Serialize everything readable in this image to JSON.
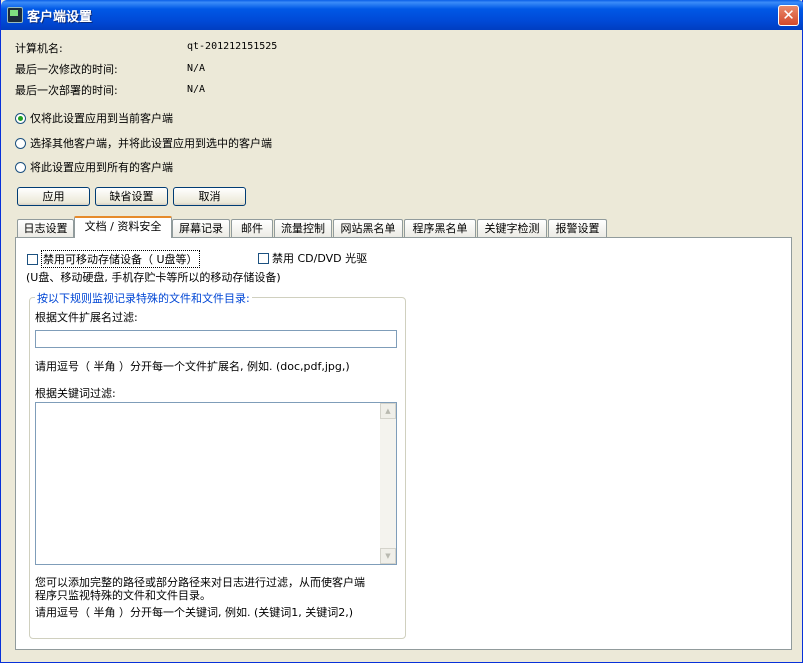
{
  "window": {
    "title": "客户端设置"
  },
  "info": {
    "computer_name_label": "计算机名:",
    "computer_name_value": "qt-201212151525",
    "last_modified_label": "最后一次修改的时间:",
    "last_modified_value": "N/A",
    "last_deployed_label": "最后一次部署的时间:",
    "last_deployed_value": "N/A"
  },
  "apply_scope": {
    "options": [
      {
        "label": "仅将此设置应用到当前客户端",
        "selected": true
      },
      {
        "label": "选择其他客户端，并将此设置应用到选中的客户端",
        "selected": false
      },
      {
        "label": "将此设置应用到所有的客户端",
        "selected": false
      }
    ]
  },
  "buttons": {
    "apply": "应用",
    "default": "缺省设置",
    "cancel": "取消"
  },
  "tabs": [
    "日志设置",
    "文档 / 资料安全",
    "屏幕记录",
    "邮件",
    "流量控制",
    "网站黑名单",
    "程序黑名单",
    "关键字检测",
    "报警设置"
  ],
  "active_tab": 1,
  "doc_security": {
    "disable_usb_label": "禁用可移动存储设备（ U盘等）",
    "disable_cd_label": "禁用 CD/DVD 光驱",
    "usb_note": "(U盘、移动硬盘, 手机存贮卡等所以的移动存储设备)",
    "group_title": "按以下规则监视记录特殊的文件和文件目录:",
    "ext_filter_label": "根据文件扩展名过滤:",
    "ext_filter_value": "",
    "ext_hint": "请用逗号（ 半角 ）分开每一个文件扩展名, 例如. (doc,pdf,jpg,)",
    "keyword_filter_label": "根据关键词过滤:",
    "keyword_filter_value": "",
    "path_hint_line1": "您可以添加完整的路径或部分路径来对日志进行过滤，从而使客户端",
    "path_hint_line2": "程序只监视特殊的文件和文件目录。",
    "keyword_hint": "请用逗号（ 半角 ）分开每一个关键词, 例如. (关键词1, 关键词2,)"
  },
  "colors": {
    "titlebar": "#0058e6",
    "active_tab_accent": "#e68b2c",
    "group_title": "#0046d5",
    "window_bg": "#ece9d8"
  }
}
